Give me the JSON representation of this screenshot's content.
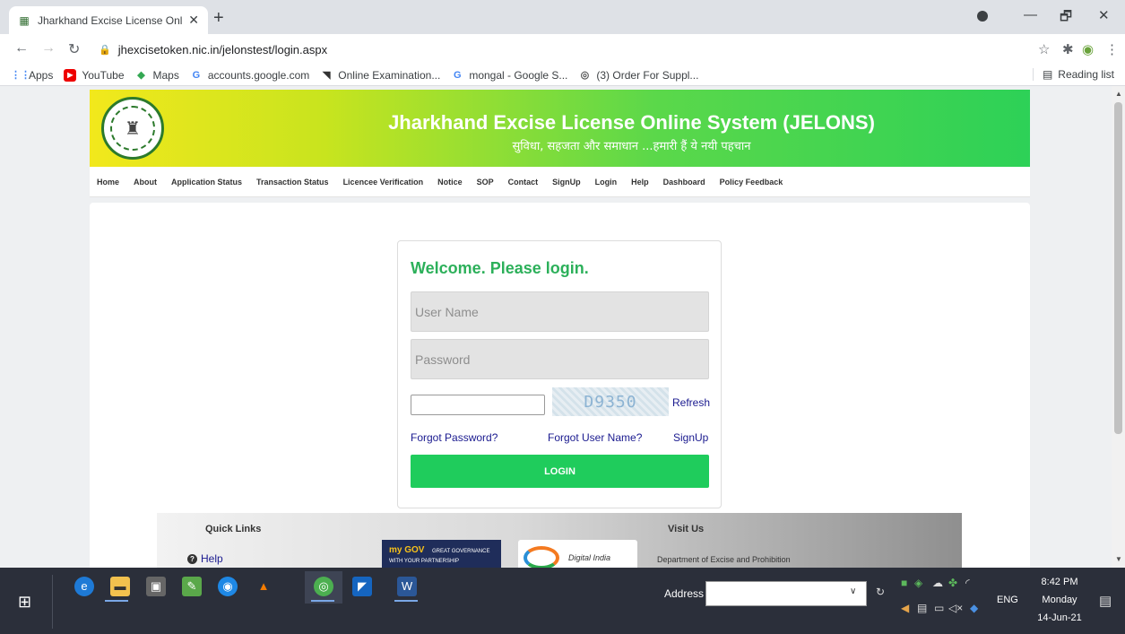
{
  "browser": {
    "tab_title": "Jharkhand Excise License Online",
    "tab_close": "✕",
    "new_tab": "+",
    "url": "jhexcisetoken.nic.in/jelonstest/login.aspx",
    "window": {
      "minimize": "—",
      "maximize": "🗗",
      "close": "✕"
    },
    "bookmarks": [
      {
        "label": "Apps",
        "icon": "apps-grid-icon"
      },
      {
        "label": "YouTube",
        "icon": "youtube-icon"
      },
      {
        "label": "Maps",
        "icon": "maps-icon"
      },
      {
        "label": "accounts.google.com",
        "icon": "google-icon"
      },
      {
        "label": "Online Examination...",
        "icon": "exam-icon"
      },
      {
        "label": "mongal - Google S...",
        "icon": "google-icon"
      },
      {
        "label": "(3) Order For Suppl...",
        "icon": "globe-icon"
      }
    ],
    "reading_list": "Reading list"
  },
  "site": {
    "title": "Jharkhand Excise License Online System (JELONS)",
    "tagline": "सुविधा, सहजता और समाधान ...हमारी हैं ये नयी पहचान",
    "nav": [
      "Home",
      "About",
      "Application Status",
      "Transaction Status",
      "Licencee Verification",
      "Notice",
      "SOP",
      "Contact",
      "SignUp",
      "Login",
      "Help",
      "Dashboard",
      "Policy Feedback"
    ]
  },
  "login": {
    "heading": "Welcome. Please login.",
    "username_placeholder": "User Name",
    "password_placeholder": "Password",
    "captcha_text": "D9350",
    "refresh": "Refresh",
    "forgot_password": "Forgot Password?",
    "forgot_username": "Forgot User Name?",
    "signup": "SignUp",
    "login_button": "LOGIN"
  },
  "footer": {
    "quick_links_title": "Quick Links",
    "help": "Help",
    "visit_title": "Visit Us",
    "visit_text": "Department of Excise and Prohibition",
    "mygov_text": "GREAT GOVERNANCE WITH YOUR PARTNERSHIP",
    "mygov_brand": "my GOV",
    "digital_india": "Digital India"
  },
  "taskbar": {
    "address_label": "Address",
    "language": "ENG",
    "time": "8:42 PM",
    "day": "Monday",
    "date": "14-Jun-21"
  }
}
